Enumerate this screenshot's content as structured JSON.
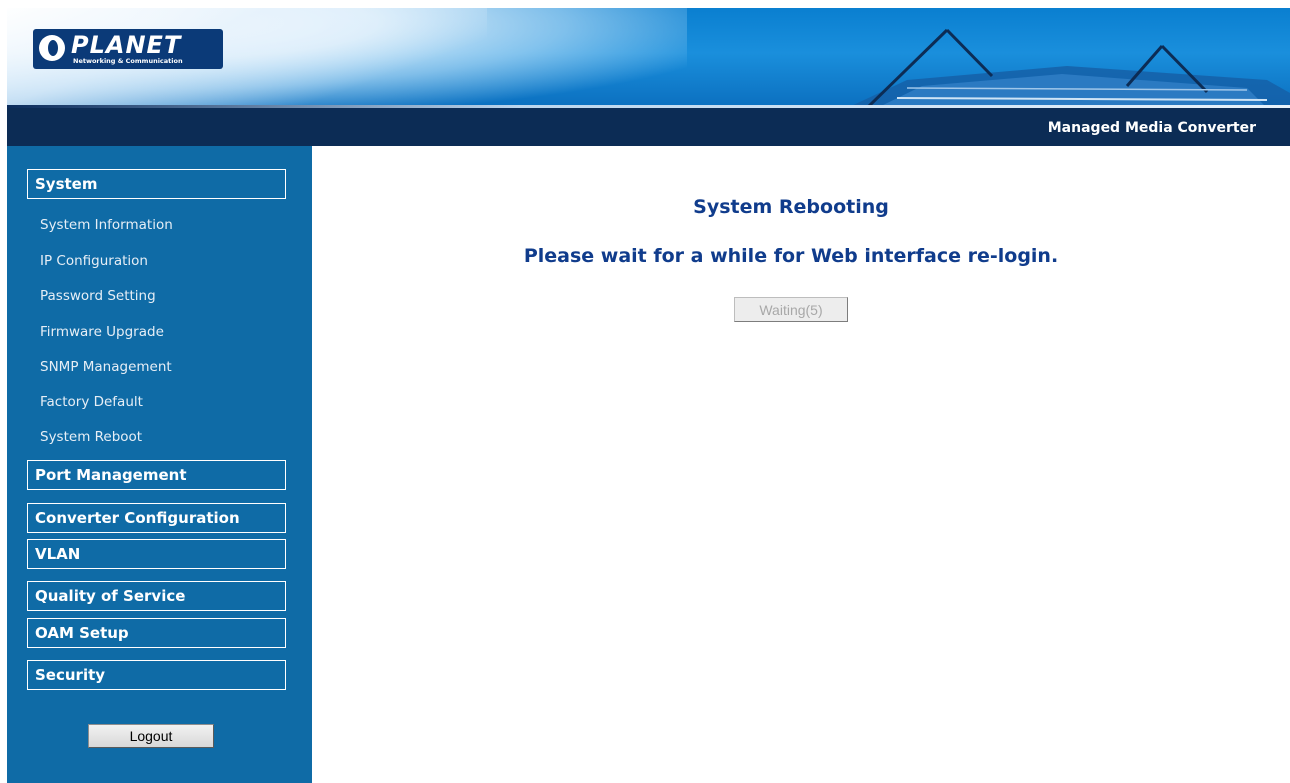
{
  "banner": {
    "logo_text": "PLANET",
    "logo_tagline": "Networking & Communication",
    "logo_icon": "planet-logo-icon"
  },
  "header": {
    "product_name": "Managed Media Converter"
  },
  "sidebar": {
    "groups": [
      {
        "label": "System",
        "items": [
          "System Information",
          "IP Configuration",
          "Password Setting",
          "Firmware Upgrade",
          "SNMP Management",
          "Factory Default",
          "System Reboot"
        ]
      },
      {
        "label": "Port Management"
      },
      {
        "label": "Converter Configuration"
      },
      {
        "label": "VLAN"
      },
      {
        "label": "Quality of Service"
      },
      {
        "label": "OAM Setup"
      },
      {
        "label": "Security"
      }
    ],
    "logout_label": "Logout"
  },
  "main": {
    "title": "System Rebooting",
    "message": "Please wait for a while for Web interface re-login.",
    "waiting_button_label": "Waiting(5)"
  },
  "colors": {
    "banner_blue": "#0a7fd0",
    "title_bar": "#0c2c55",
    "sidebar": "#0f6ba6",
    "heading_text": "#103c8c"
  }
}
